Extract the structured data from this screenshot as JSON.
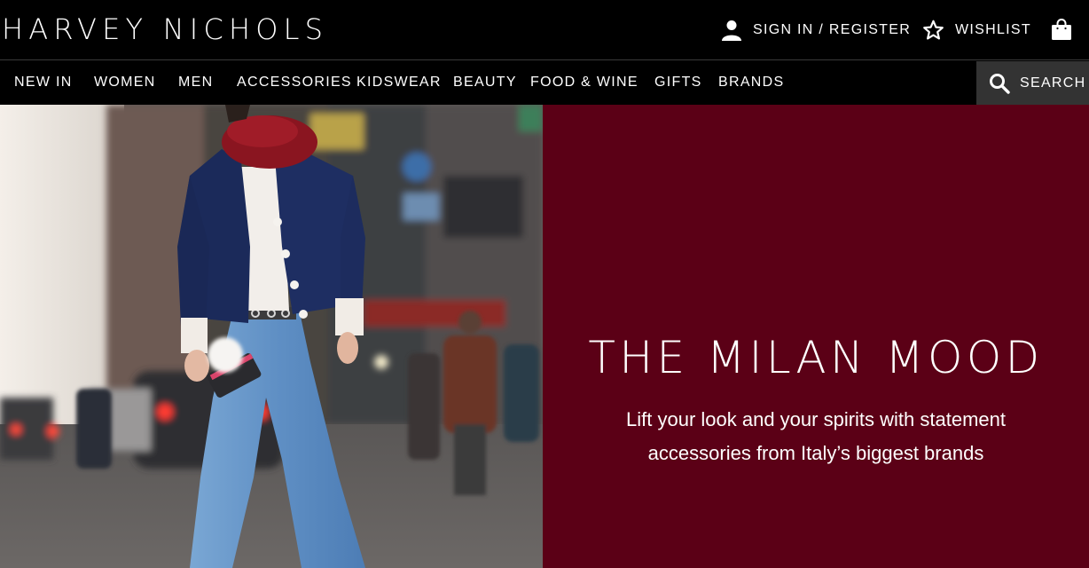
{
  "header": {
    "logo": "HARVEY NICHOLS",
    "sign_in": "SIGN IN / REGISTER",
    "wishlist": "WISHLIST",
    "icons": {
      "account": "user-icon",
      "wishlist": "star-icon",
      "bag": "shopping-bag-icon"
    }
  },
  "nav": {
    "items": [
      "NEW IN",
      "WOMEN",
      "MEN",
      "ACCESSORIES",
      "KIDSWEAR",
      "BEAUTY",
      "FOOD & WINE",
      "GIFTS",
      "BRANDS"
    ],
    "search_label": "SEARCH",
    "search_icon": "search-icon"
  },
  "hero": {
    "title": "THE MILAN MOOD",
    "subtitle": "Lift your look and your spirits with statement accessories from Italy’s biggest brands",
    "panel_color": "#5b0016"
  }
}
